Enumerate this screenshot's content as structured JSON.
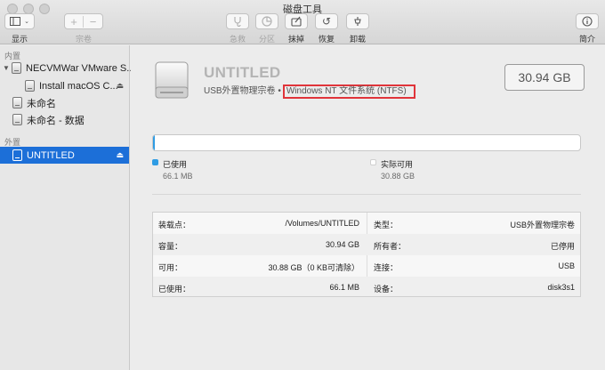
{
  "window": {
    "title": "磁盘工具"
  },
  "toolbar": {
    "view_label": "显示",
    "volume_label": "宗卷",
    "first_aid_label": "急救",
    "partition_label": "分区",
    "erase_label": "抹掉",
    "restore_label": "恢复",
    "unmount_label": "卸载",
    "info_label": "简介"
  },
  "sidebar": {
    "internal_heading": "内置",
    "external_heading": "外置",
    "items": [
      {
        "label": "NECVMWar VMware S..."
      },
      {
        "label": "Install macOS C..."
      },
      {
        "label": "未命名"
      },
      {
        "label": "未命名 - 数据"
      },
      {
        "label": "UNTITLED"
      }
    ]
  },
  "volume": {
    "name": "UNTITLED",
    "kind": "USB外置物理宗卷 •",
    "format": "Windows NT 文件系统 (NTFS)",
    "capacity": "30.94 GB"
  },
  "usage": {
    "used_fraction": 0.0021,
    "used_color": "#2f9ce4",
    "used_label": "已使用",
    "used_value": "66.1 MB",
    "free_label": "实际可用",
    "free_value": "30.88 GB"
  },
  "info": {
    "mount_point_label": "装载点：",
    "mount_point_value": "/Volumes/UNTITLED",
    "capacity_label": "容量：",
    "capacity_value": "30.94 GB",
    "available_label": "可用：",
    "available_value": "30.88 GB（0 KB可清除）",
    "used_label": "已使用：",
    "used_value": "66.1 MB",
    "type_label": "类型：",
    "type_value": "USB外置物理宗卷",
    "owner_label": "所有者：",
    "owner_value": "已停用",
    "connection_label": "连接：",
    "connection_value": "USB",
    "device_label": "设备：",
    "device_value": "disk3s1"
  }
}
